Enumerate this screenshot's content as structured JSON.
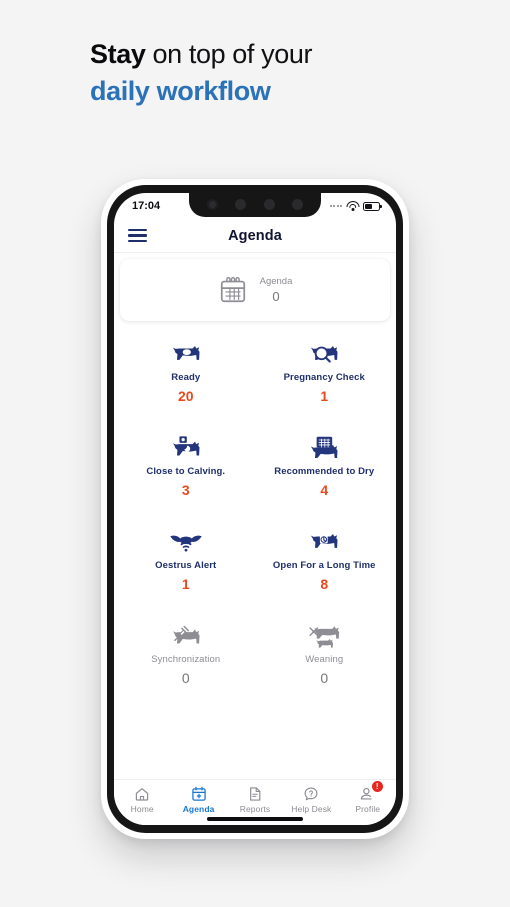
{
  "headline": {
    "line1_bold": "Stay",
    "line1_rest": " on top of your",
    "line2": "daily workflow",
    "accent_color": "#2b72b8"
  },
  "phone": {
    "status_bar": {
      "time": "17:04",
      "signal_icon": "signal-dots-icon",
      "wifi_icon": "wifi-icon",
      "battery_icon": "battery-half-icon"
    },
    "app_bar": {
      "menu_icon": "hamburger-menu-icon",
      "title": "Agenda"
    },
    "agenda_summary": {
      "icon": "calendar-icon",
      "label": "Agenda",
      "count": "0"
    },
    "tiles": [
      {
        "icon": "cow-ready-icon",
        "label": "Ready",
        "count": "20",
        "disabled": false
      },
      {
        "icon": "cow-magnifier-icon",
        "label": "Pregnancy Check",
        "count": "1",
        "disabled": false
      },
      {
        "icon": "cow-calving-icon",
        "label": "Close to Calving.",
        "count": "3",
        "disabled": false
      },
      {
        "icon": "cow-calendar-dry-icon",
        "label": "Recommended to Dry",
        "count": "4",
        "disabled": false
      },
      {
        "icon": "oestrus-sensor-icon",
        "label": "Oestrus Alert",
        "count": "1",
        "disabled": false
      },
      {
        "icon": "cow-open-long-time-icon",
        "label": "Open For a Long Time",
        "count": "8",
        "disabled": false
      },
      {
        "icon": "cow-syringe-icon",
        "label": "Synchronization",
        "count": "0",
        "disabled": true
      },
      {
        "icon": "cow-calf-weaning-icon",
        "label": "Weaning",
        "count": "0",
        "disabled": true
      }
    ],
    "tab_bar": [
      {
        "icon": "home-icon",
        "label": "Home",
        "active": false,
        "badge": ""
      },
      {
        "icon": "calendar-plus-icon",
        "label": "Agenda",
        "active": true,
        "badge": ""
      },
      {
        "icon": "document-icon",
        "label": "Reports",
        "active": false,
        "badge": ""
      },
      {
        "icon": "question-chat-icon",
        "label": "Help Desk",
        "active": false,
        "badge": ""
      },
      {
        "icon": "person-icon",
        "label": "Profile",
        "active": false,
        "badge": "!"
      }
    ]
  },
  "colors": {
    "page_background": "#f4f4f4",
    "navy": "#1f2f6b",
    "orange": "#e8491d",
    "accent_blue": "#1778d4",
    "muted_grey": "#8d8d93",
    "badge_red": "#e8271f"
  }
}
